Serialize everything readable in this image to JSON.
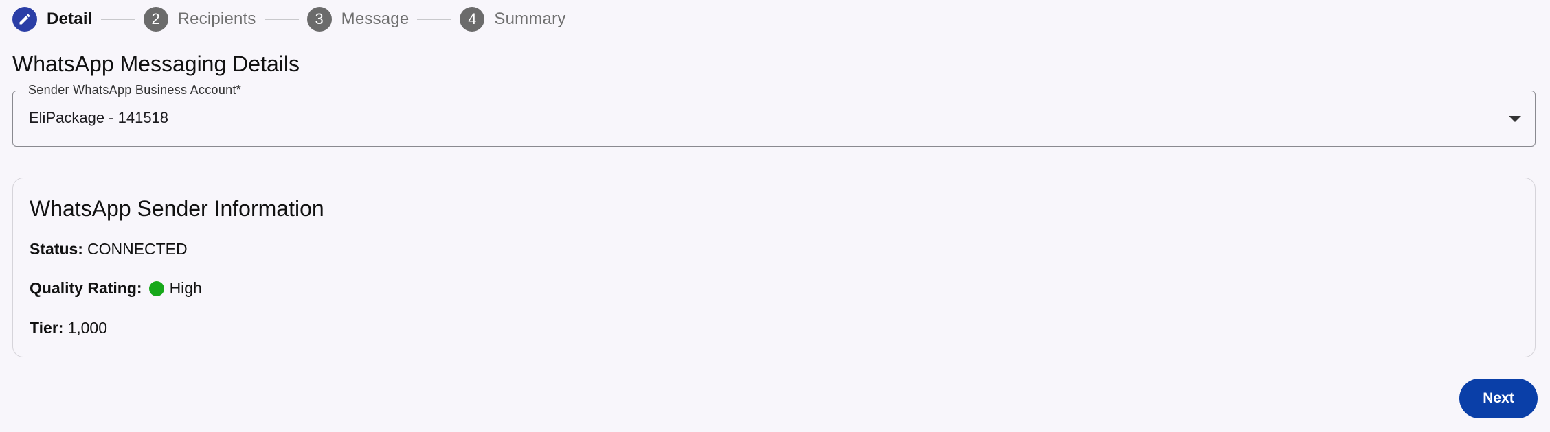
{
  "stepper": {
    "steps": [
      {
        "number": "",
        "label": "Detail",
        "icon": "pencil-icon",
        "active": true
      },
      {
        "number": "2",
        "label": "Recipients",
        "active": false
      },
      {
        "number": "3",
        "label": "Message",
        "active": false
      },
      {
        "number": "4",
        "label": "Summary",
        "active": false
      }
    ]
  },
  "page": {
    "title": "WhatsApp Messaging Details"
  },
  "sender_select": {
    "label": "Sender WhatsApp Business Account*",
    "value": "EliPackage - 141518",
    "icon": "chevron-down-icon"
  },
  "sender_info": {
    "title": "WhatsApp Sender Information",
    "status_label": "Status:",
    "status_value": "CONNECTED",
    "quality_label": "Quality Rating:",
    "quality_value": "High",
    "quality_color": "#17a81a",
    "tier_label": "Tier:",
    "tier_value": "1,000"
  },
  "actions": {
    "next_label": "Next"
  },
  "colors": {
    "accent": "#0a3fa8",
    "active_step": "#2b3ea6",
    "inactive_step": "#6b6b6b",
    "background": "#f8f6fb"
  }
}
